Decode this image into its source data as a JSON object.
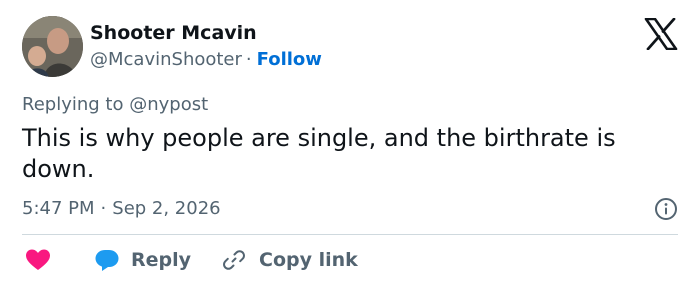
{
  "author": {
    "name": "Shooter Mcavin",
    "handle": "@McavinShooter",
    "separator": "·",
    "follow_label": "Follow"
  },
  "reply_context": {
    "prefix": "Replying to",
    "mention": "@nypost"
  },
  "tweet": {
    "text": "This is why people are single, and the birthrate is down.",
    "time": "5:47 PM",
    "separator": "·",
    "date": "Sep 2, 2026"
  },
  "actions": {
    "reply_label": "Reply",
    "copy_label": "Copy link"
  },
  "colors": {
    "accent": "#006fd6",
    "like": "#f91880",
    "reply": "#1d9bf0",
    "muted": "#536471",
    "text": "#0f1419"
  },
  "icons": [
    "x-logo-icon",
    "info-icon",
    "heart-icon",
    "reply-bubble-icon",
    "link-icon"
  ]
}
